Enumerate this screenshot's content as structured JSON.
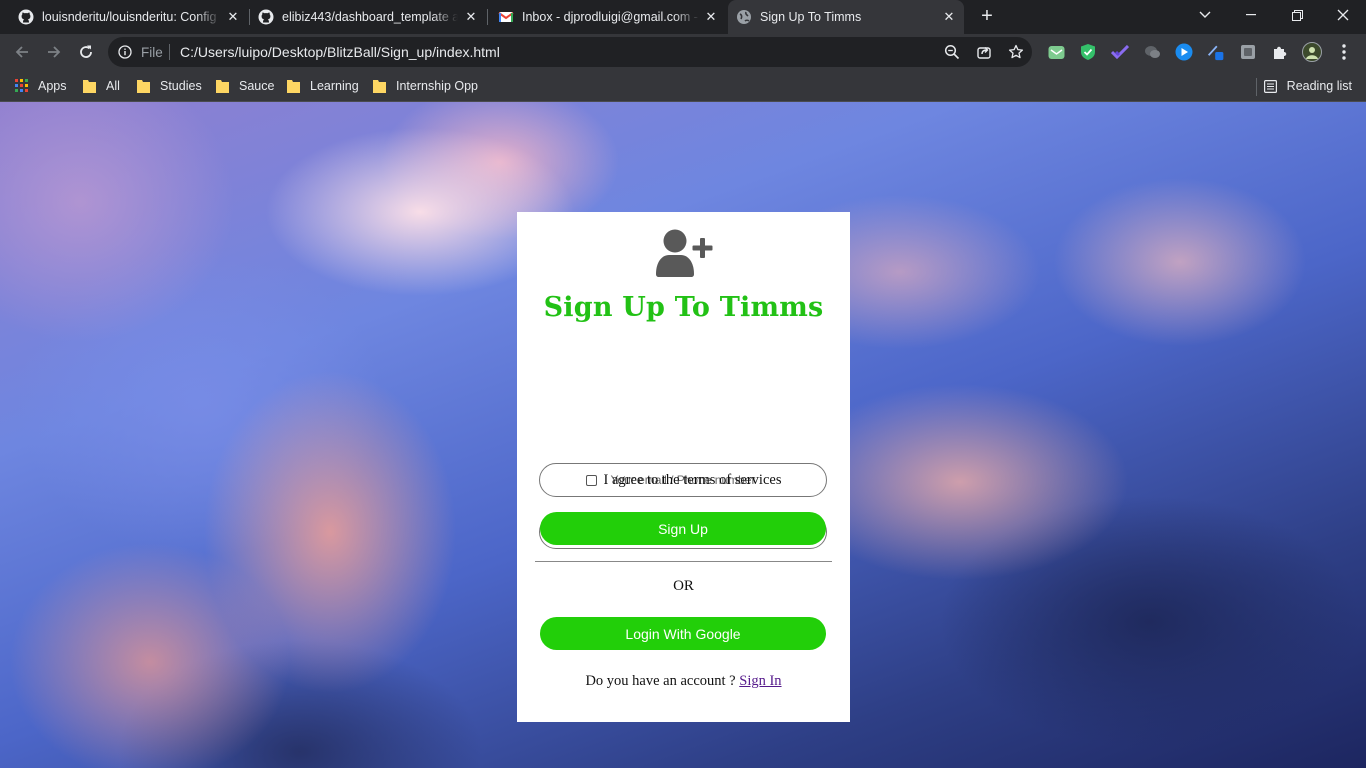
{
  "browser": {
    "tabs": [
      {
        "title": "louisnderitu/louisnderitu: Config",
        "icon": "github-icon",
        "active": false
      },
      {
        "title": "elibiz443/dashboard_template at",
        "icon": "github-icon",
        "active": false
      },
      {
        "title": "Inbox - djprodluigi@gmail.com -",
        "icon": "gmail-icon",
        "active": false
      },
      {
        "title": "Sign Up To Timms",
        "icon": "globe-icon",
        "active": true
      }
    ],
    "address": {
      "scheme_label": "File",
      "url": "C:/Users/luipo/Desktop/BlitzBall/Sign_up/index.html"
    },
    "bookmarks": [
      {
        "label": "Apps",
        "icon": "apps-grid-icon"
      },
      {
        "label": "All",
        "icon": "folder-icon"
      },
      {
        "label": "Studies",
        "icon": "folder-icon"
      },
      {
        "label": "Sauce",
        "icon": "folder-icon"
      },
      {
        "label": "Learning",
        "icon": "folder-icon"
      },
      {
        "label": "Internship Opp",
        "icon": "folder-icon"
      }
    ],
    "reading_list_label": "Reading list"
  },
  "signup": {
    "icon": "user-plus-icon",
    "title": "Sign Up To Timms",
    "email_placeholder": "Your email / Phone number",
    "password_placeholder": "Your Password",
    "terms_label": "I agree to the terms of services",
    "terms_checked": false,
    "signup_button": "Sign Up",
    "or_label": "OR",
    "google_button": "Login With Google",
    "account_prompt": "Do you have an account ?",
    "signin_link": "Sign In"
  },
  "colors": {
    "accent_green": "#22cf09",
    "title_green": "#22c115",
    "link_purple": "#551a8b"
  }
}
